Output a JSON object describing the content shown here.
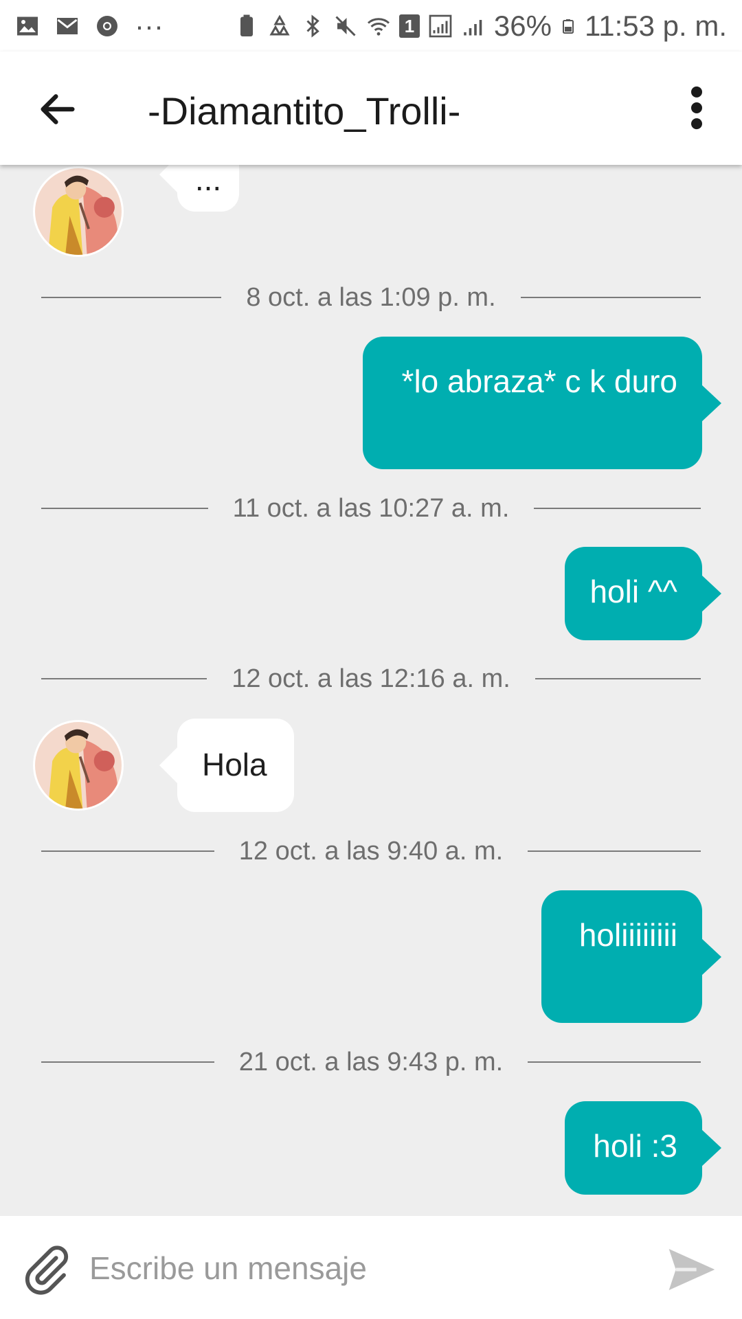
{
  "status_bar": {
    "battery_percent": "36%",
    "time": "11:53 p. m.",
    "notification_badge": "1",
    "overflow": "···"
  },
  "header": {
    "title": "-Diamantito_Trolli-"
  },
  "messages": [
    {
      "type": "in",
      "text": "..."
    },
    {
      "type": "date",
      "text": "8 oct. a las 1:09 p. m."
    },
    {
      "type": "out",
      "text": "*lo abraza* c k duro"
    },
    {
      "type": "date",
      "text": "11 oct. a las 10:27 a. m."
    },
    {
      "type": "out",
      "text": "holi ^^"
    },
    {
      "type": "date",
      "text": "12 oct. a las 12:16 a. m."
    },
    {
      "type": "in",
      "text": "Hola"
    },
    {
      "type": "date",
      "text": "12 oct. a las 9:40 a. m."
    },
    {
      "type": "out",
      "text": "holiiiiiiii"
    },
    {
      "type": "date",
      "text": "21 oct. a las 9:43 p. m."
    },
    {
      "type": "out",
      "text": "holi :3"
    }
  ],
  "composer": {
    "placeholder": "Escribe un mensaje"
  },
  "colors": {
    "outgoing_bubble": "#00aeb0",
    "background": "#eeeeee"
  }
}
